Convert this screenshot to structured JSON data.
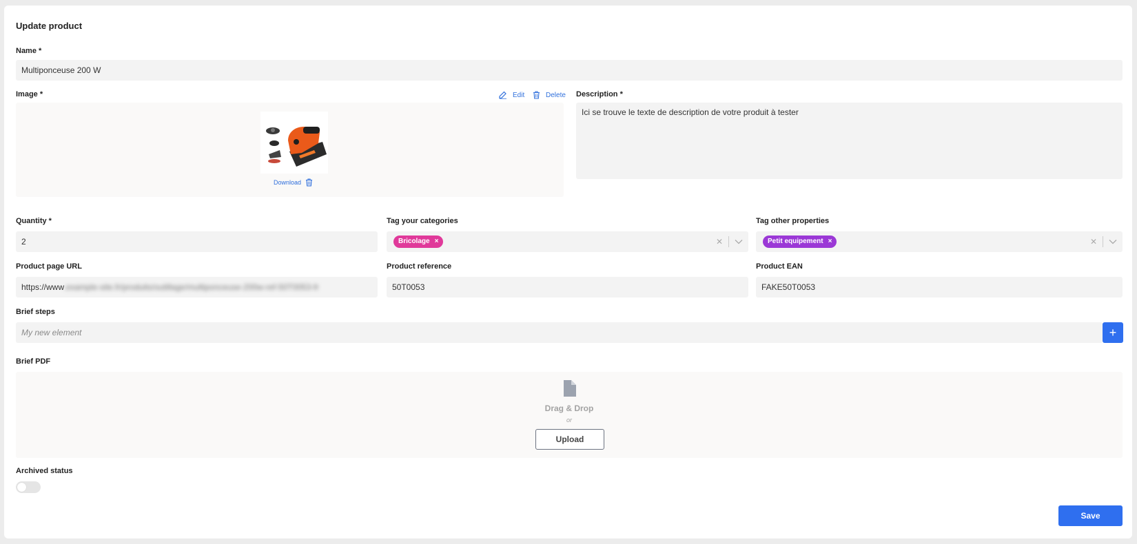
{
  "page": {
    "title": "Update product",
    "accent": "#2f6fef"
  },
  "name": {
    "label": "Name *",
    "value": "Multiponceuse 200 W"
  },
  "image": {
    "label": "Image *",
    "edit_label": "Edit",
    "delete_label": "Delete",
    "download_label": "Download",
    "product_icon": "sander-photo"
  },
  "description": {
    "label": "Description *",
    "value": "Ici se trouve le texte de description de votre produit à tester"
  },
  "quantity": {
    "label": "Quantity *",
    "value": "2"
  },
  "categories": {
    "label": "Tag your categories",
    "tags": [
      {
        "label": "Bricolage",
        "color": "#e0399a"
      }
    ]
  },
  "properties": {
    "label": "Tag other properties",
    "tags": [
      {
        "label": "Petit equipement",
        "color": "#9b38d6"
      }
    ]
  },
  "product_url": {
    "label": "Product page URL",
    "value_visible": "https://www",
    "value_blurred": ".example-site.fr/produits/outillage/multiponceuse-200w-ref-50T0053-fr"
  },
  "product_reference": {
    "label": "Product reference",
    "value": "50T0053"
  },
  "product_ean": {
    "label": "Product EAN",
    "value": "FAKE50T0053"
  },
  "brief_steps": {
    "label": "Brief steps",
    "placeholder": "My new element",
    "add_label": "+"
  },
  "brief_pdf": {
    "label": "Brief PDF",
    "drag_drop": "Drag & Drop",
    "or": "or",
    "upload_label": "Upload"
  },
  "archived": {
    "label": "Archived status",
    "enabled": false
  },
  "save_label": "Save"
}
